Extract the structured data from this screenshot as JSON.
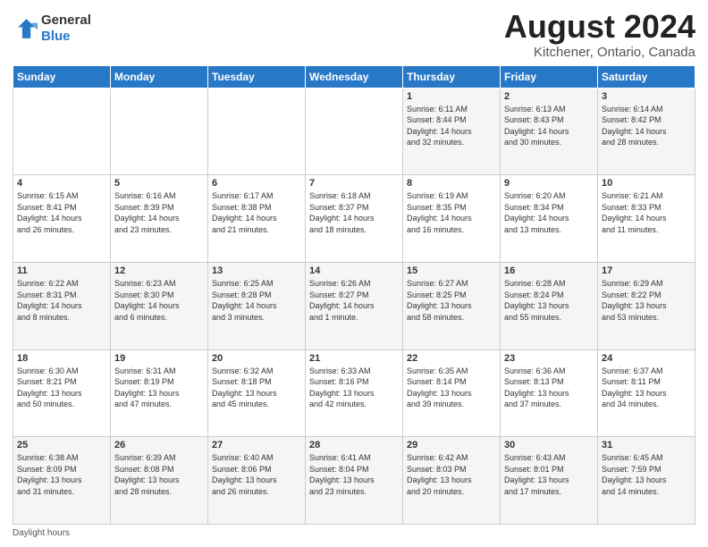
{
  "logo": {
    "line1": "General",
    "line2": "Blue"
  },
  "title": "August 2024",
  "location": "Kitchener, Ontario, Canada",
  "days_of_week": [
    "Sunday",
    "Monday",
    "Tuesday",
    "Wednesday",
    "Thursday",
    "Friday",
    "Saturday"
  ],
  "footer_label": "Daylight hours",
  "weeks": [
    [
      {
        "day": "",
        "info": ""
      },
      {
        "day": "",
        "info": ""
      },
      {
        "day": "",
        "info": ""
      },
      {
        "day": "",
        "info": ""
      },
      {
        "day": "1",
        "info": "Sunrise: 6:11 AM\nSunset: 8:44 PM\nDaylight: 14 hours\nand 32 minutes."
      },
      {
        "day": "2",
        "info": "Sunrise: 6:13 AM\nSunset: 8:43 PM\nDaylight: 14 hours\nand 30 minutes."
      },
      {
        "day": "3",
        "info": "Sunrise: 6:14 AM\nSunset: 8:42 PM\nDaylight: 14 hours\nand 28 minutes."
      }
    ],
    [
      {
        "day": "4",
        "info": "Sunrise: 6:15 AM\nSunset: 8:41 PM\nDaylight: 14 hours\nand 26 minutes."
      },
      {
        "day": "5",
        "info": "Sunrise: 6:16 AM\nSunset: 8:39 PM\nDaylight: 14 hours\nand 23 minutes."
      },
      {
        "day": "6",
        "info": "Sunrise: 6:17 AM\nSunset: 8:38 PM\nDaylight: 14 hours\nand 21 minutes."
      },
      {
        "day": "7",
        "info": "Sunrise: 6:18 AM\nSunset: 8:37 PM\nDaylight: 14 hours\nand 18 minutes."
      },
      {
        "day": "8",
        "info": "Sunrise: 6:19 AM\nSunset: 8:35 PM\nDaylight: 14 hours\nand 16 minutes."
      },
      {
        "day": "9",
        "info": "Sunrise: 6:20 AM\nSunset: 8:34 PM\nDaylight: 14 hours\nand 13 minutes."
      },
      {
        "day": "10",
        "info": "Sunrise: 6:21 AM\nSunset: 8:33 PM\nDaylight: 14 hours\nand 11 minutes."
      }
    ],
    [
      {
        "day": "11",
        "info": "Sunrise: 6:22 AM\nSunset: 8:31 PM\nDaylight: 14 hours\nand 8 minutes."
      },
      {
        "day": "12",
        "info": "Sunrise: 6:23 AM\nSunset: 8:30 PM\nDaylight: 14 hours\nand 6 minutes."
      },
      {
        "day": "13",
        "info": "Sunrise: 6:25 AM\nSunset: 8:28 PM\nDaylight: 14 hours\nand 3 minutes."
      },
      {
        "day": "14",
        "info": "Sunrise: 6:26 AM\nSunset: 8:27 PM\nDaylight: 14 hours\nand 1 minute."
      },
      {
        "day": "15",
        "info": "Sunrise: 6:27 AM\nSunset: 8:25 PM\nDaylight: 13 hours\nand 58 minutes."
      },
      {
        "day": "16",
        "info": "Sunrise: 6:28 AM\nSunset: 8:24 PM\nDaylight: 13 hours\nand 55 minutes."
      },
      {
        "day": "17",
        "info": "Sunrise: 6:29 AM\nSunset: 8:22 PM\nDaylight: 13 hours\nand 53 minutes."
      }
    ],
    [
      {
        "day": "18",
        "info": "Sunrise: 6:30 AM\nSunset: 8:21 PM\nDaylight: 13 hours\nand 50 minutes."
      },
      {
        "day": "19",
        "info": "Sunrise: 6:31 AM\nSunset: 8:19 PM\nDaylight: 13 hours\nand 47 minutes."
      },
      {
        "day": "20",
        "info": "Sunrise: 6:32 AM\nSunset: 8:18 PM\nDaylight: 13 hours\nand 45 minutes."
      },
      {
        "day": "21",
        "info": "Sunrise: 6:33 AM\nSunset: 8:16 PM\nDaylight: 13 hours\nand 42 minutes."
      },
      {
        "day": "22",
        "info": "Sunrise: 6:35 AM\nSunset: 8:14 PM\nDaylight: 13 hours\nand 39 minutes."
      },
      {
        "day": "23",
        "info": "Sunrise: 6:36 AM\nSunset: 8:13 PM\nDaylight: 13 hours\nand 37 minutes."
      },
      {
        "day": "24",
        "info": "Sunrise: 6:37 AM\nSunset: 8:11 PM\nDaylight: 13 hours\nand 34 minutes."
      }
    ],
    [
      {
        "day": "25",
        "info": "Sunrise: 6:38 AM\nSunset: 8:09 PM\nDaylight: 13 hours\nand 31 minutes."
      },
      {
        "day": "26",
        "info": "Sunrise: 6:39 AM\nSunset: 8:08 PM\nDaylight: 13 hours\nand 28 minutes."
      },
      {
        "day": "27",
        "info": "Sunrise: 6:40 AM\nSunset: 8:06 PM\nDaylight: 13 hours\nand 26 minutes."
      },
      {
        "day": "28",
        "info": "Sunrise: 6:41 AM\nSunset: 8:04 PM\nDaylight: 13 hours\nand 23 minutes."
      },
      {
        "day": "29",
        "info": "Sunrise: 6:42 AM\nSunset: 8:03 PM\nDaylight: 13 hours\nand 20 minutes."
      },
      {
        "day": "30",
        "info": "Sunrise: 6:43 AM\nSunset: 8:01 PM\nDaylight: 13 hours\nand 17 minutes."
      },
      {
        "day": "31",
        "info": "Sunrise: 6:45 AM\nSunset: 7:59 PM\nDaylight: 13 hours\nand 14 minutes."
      }
    ]
  ]
}
